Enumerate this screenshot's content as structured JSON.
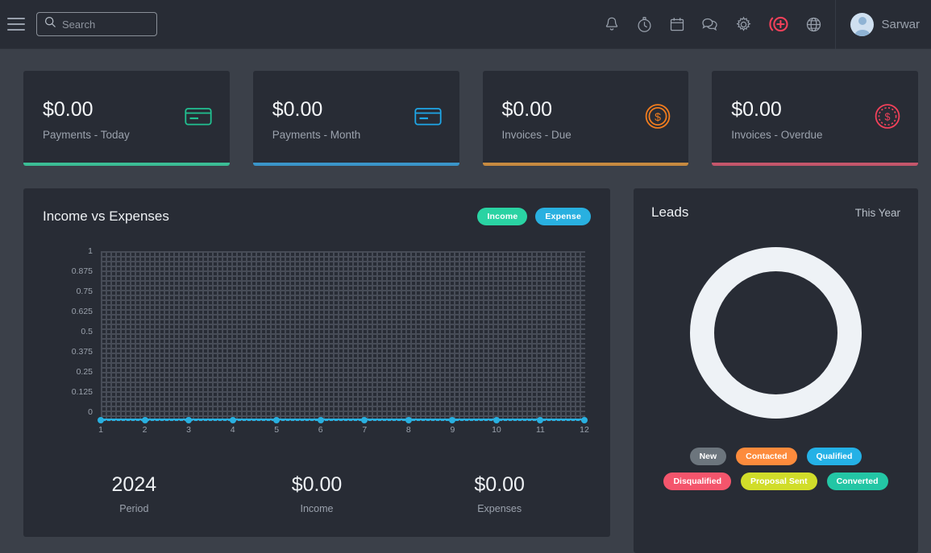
{
  "header": {
    "menu_icon": "hamburger-icon",
    "search": {
      "value": "",
      "placeholder": "Search",
      "icon": "search-icon"
    },
    "icons": [
      {
        "name": "bell-icon",
        "label": "Notifications"
      },
      {
        "name": "stopwatch-icon",
        "label": "Timer"
      },
      {
        "name": "calendar-icon",
        "label": "Calendar"
      },
      {
        "name": "chat-icon",
        "label": "Messages"
      },
      {
        "name": "gear-icon",
        "label": "Settings"
      },
      {
        "name": "add-circle-icon",
        "label": "Quick Add"
      },
      {
        "name": "globe-icon",
        "label": "Language"
      }
    ],
    "user": {
      "name": "Sarwar",
      "avatar": "avatar-icon"
    }
  },
  "stats": [
    {
      "value": "$0.00",
      "label": "Payments - Today",
      "accent": "#3bbd95",
      "icon": "credit-card-icon"
    },
    {
      "value": "$0.00",
      "label": "Payments - Month",
      "accent": "#3a95c9",
      "icon": "credit-card-icon"
    },
    {
      "value": "$0.00",
      "label": "Invoices - Due",
      "accent": "#c78a40",
      "icon": "coin-dollar-icon"
    },
    {
      "value": "$0.00",
      "label": "Invoices - Overdue",
      "accent": "#c4566b",
      "icon": "coin-dollar-dashed-icon"
    }
  ],
  "stat_icon_colors": {
    "payments_today": "#21c191",
    "payments_month": "#1ea7e8",
    "invoices_due": "#f07c1e",
    "invoices_overdue": "#f2415a"
  },
  "income_chart": {
    "title": "Income vs Expenses",
    "legend": [
      {
        "label": "Income",
        "color": "#2ad3a3"
      },
      {
        "label": "Expense",
        "color": "#29b0e0"
      }
    ],
    "summary": [
      {
        "value": "2024",
        "label": "Period"
      },
      {
        "value": "$0.00",
        "label": "Income"
      },
      {
        "value": "$0.00",
        "label": "Expenses"
      }
    ]
  },
  "chart_data": {
    "type": "line",
    "title": "Income vs Expenses",
    "xlabel": "",
    "ylabel": "",
    "x": [
      1,
      2,
      3,
      4,
      5,
      6,
      7,
      8,
      9,
      10,
      11,
      12
    ],
    "xtick_labels": [
      "1",
      "2",
      "3",
      "4",
      "5",
      "6",
      "7",
      "8",
      "9",
      "10",
      "11",
      "12"
    ],
    "ytick_labels": [
      "1",
      "0.875",
      "0.75",
      "0.625",
      "0.5",
      "0.375",
      "0.25",
      "0.125",
      "0"
    ],
    "ylim": [
      0,
      1
    ],
    "grid": true,
    "legend_position": "top-right",
    "series": [
      {
        "name": "Income",
        "color": "#2ad3a3",
        "values": [
          0,
          0,
          0,
          0,
          0,
          0,
          0,
          0,
          0,
          0,
          0,
          0
        ]
      },
      {
        "name": "Expense",
        "color": "#29b0e0",
        "values": [
          0,
          0,
          0,
          0,
          0,
          0,
          0,
          0,
          0,
          0,
          0,
          0
        ]
      }
    ]
  },
  "leads": {
    "title": "Leads",
    "period": "This Year",
    "donut_color": "#eef2f6",
    "statuses": [
      {
        "label": "New",
        "color": "#6c757d"
      },
      {
        "label": "Contacted",
        "color": "#fd8b3c"
      },
      {
        "label": "Qualified",
        "color": "#24b1e6"
      },
      {
        "label": "Disqualified",
        "color": "#f4556c"
      },
      {
        "label": "Proposal Sent",
        "color": "#d1dd2a"
      },
      {
        "label": "Converted",
        "color": "#23c6a5"
      }
    ]
  },
  "leads_chart_data": {
    "type": "pie",
    "title": "Leads",
    "subtitle": "This Year",
    "labels": [
      "New",
      "Contacted",
      "Qualified",
      "Disqualified",
      "Proposal Sent",
      "Converted"
    ],
    "values": [
      0,
      0,
      0,
      0,
      0,
      0
    ],
    "colors": [
      "#6c757d",
      "#fd8b3c",
      "#24b1e6",
      "#f4556c",
      "#d1dd2a",
      "#23c6a5"
    ],
    "legend_position": "bottom"
  }
}
